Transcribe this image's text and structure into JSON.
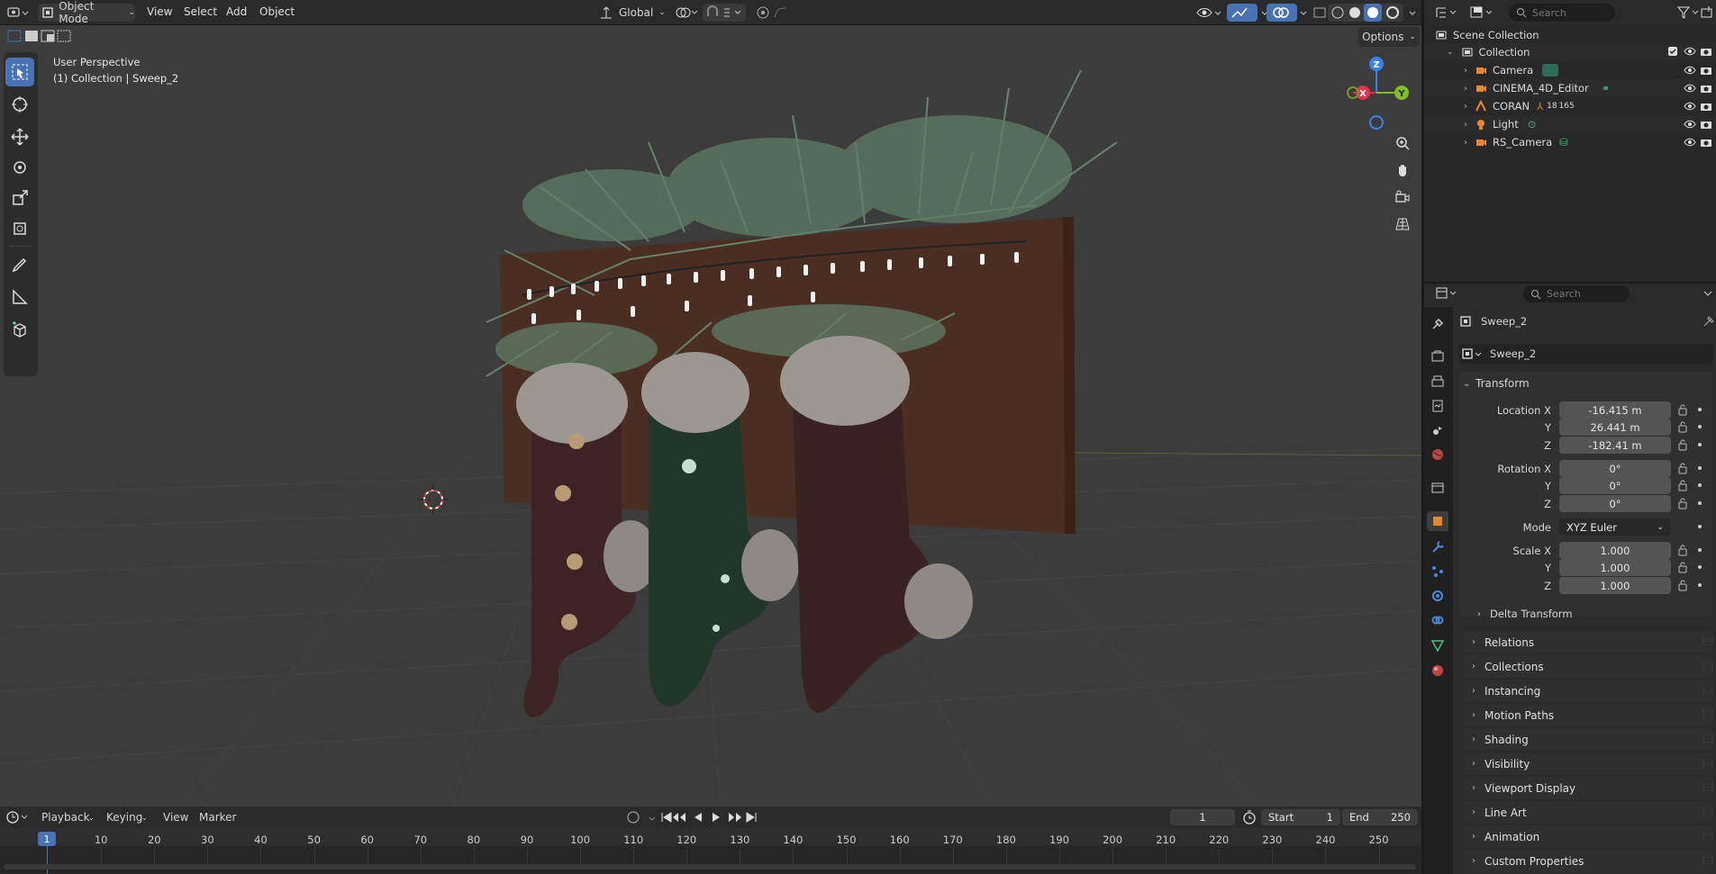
{
  "header": {
    "mode": "Object Mode",
    "menus": [
      "View",
      "Select",
      "Add",
      "Object"
    ],
    "orientation": "Global",
    "options_label": "Options"
  },
  "viewport": {
    "perspective_label": "User Perspective",
    "collection_label": "(1) Collection | Sweep_2",
    "gizmo": {
      "z": "Z",
      "y": "Y",
      "x": "X"
    }
  },
  "outliner": {
    "search_placeholder": "Search",
    "root": "Scene Collection",
    "collection": "Collection",
    "items": [
      {
        "name": "Camera"
      },
      {
        "name": "CINEMA_4D_Editor"
      },
      {
        "name": "CORAN",
        "badge": "18",
        "badge2": "165"
      },
      {
        "name": "Light"
      },
      {
        "name": "RS_Camera"
      }
    ]
  },
  "properties": {
    "search_placeholder": "Search",
    "object_name": "Sweep_2",
    "datablock_name": "Sweep_2",
    "transform": {
      "title": "Transform",
      "location_label": "Location X",
      "location": {
        "x": "-16.415 m",
        "y": "26.441 m",
        "z": "-182.41 m"
      },
      "rotation_label": "Rotation X",
      "rotation": {
        "x": "0°",
        "y": "0°",
        "z": "0°"
      },
      "mode_label": "Mode",
      "mode_value": "XYZ Euler",
      "scale_label": "Scale X",
      "scale": {
        "x": "1.000",
        "y": "1.000",
        "z": "1.000"
      },
      "axis_y": "Y",
      "axis_z": "Z"
    },
    "delta_transform": "Delta Transform",
    "panels": [
      "Relations",
      "Collections",
      "Instancing",
      "Motion Paths",
      "Shading",
      "Visibility",
      "Viewport Display",
      "Line Art",
      "Animation",
      "Custom Properties"
    ]
  },
  "timeline": {
    "menus": [
      "Playback",
      "Keying",
      "View",
      "Marker"
    ],
    "current_frame": "1",
    "start_label": "Start",
    "start": "1",
    "end_label": "End",
    "end": "250",
    "ticks": [
      "10",
      "20",
      "30",
      "40",
      "50",
      "60",
      "70",
      "80",
      "90",
      "100",
      "110",
      "120",
      "130",
      "140",
      "150",
      "160",
      "170",
      "180",
      "190",
      "200",
      "210",
      "220",
      "230",
      "240",
      "250"
    ],
    "playhead": "1"
  },
  "colors": {
    "accent": "#4772b3",
    "viewport_bg": "#3c3c3c",
    "x_axis": "#e0344c",
    "y_axis": "#7fbf2a",
    "z_axis": "#3b82e6"
  }
}
